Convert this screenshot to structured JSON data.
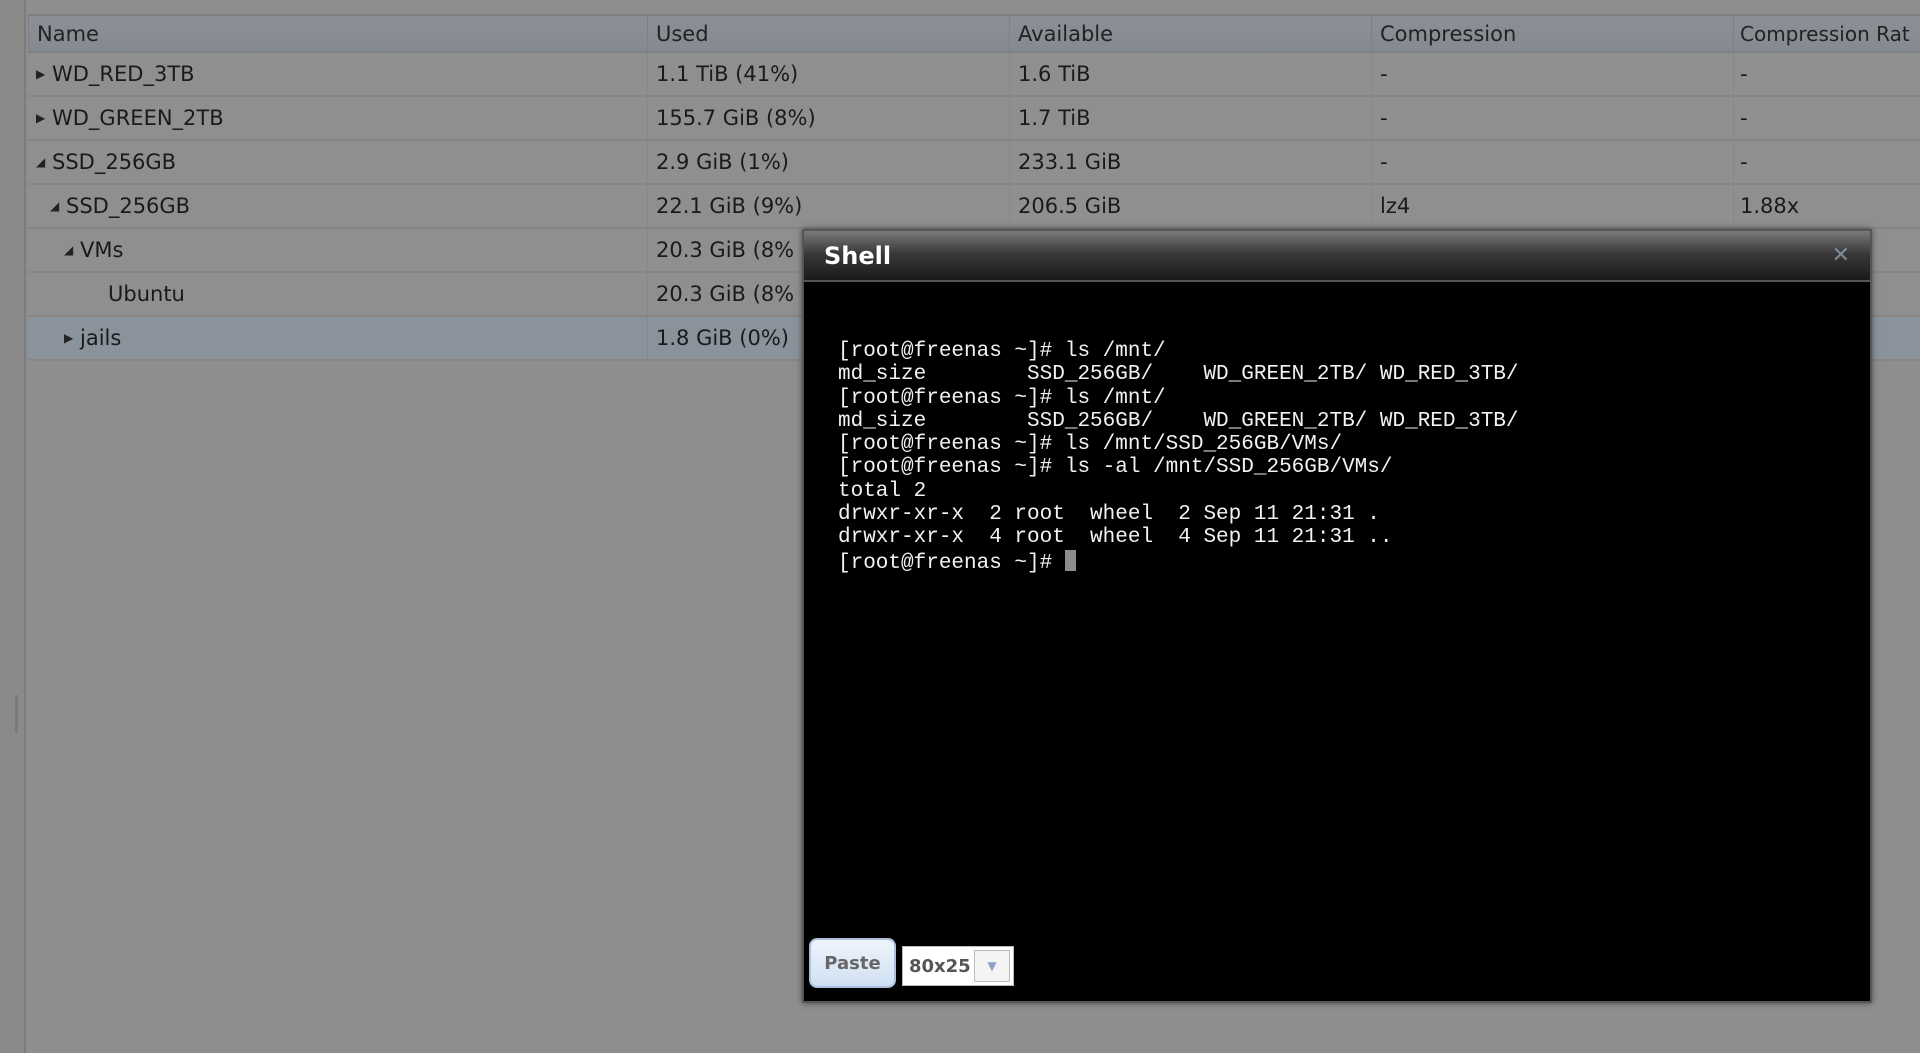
{
  "table": {
    "columns": [
      "Name",
      "Used",
      "Available",
      "Compression",
      "Compression Rat"
    ],
    "rows": [
      {
        "name": "WD_RED_3TB",
        "toggle": "collapsed",
        "level": 0,
        "used": "1.1 TiB (41%)",
        "available": "1.6 TiB",
        "compression": "-",
        "ratio": "-"
      },
      {
        "name": "WD_GREEN_2TB",
        "toggle": "collapsed",
        "level": 0,
        "used": "155.7 GiB (8%)",
        "available": "1.7 TiB",
        "compression": "-",
        "ratio": "-"
      },
      {
        "name": "SSD_256GB",
        "toggle": "expanded",
        "level": 0,
        "used": "2.9 GiB (1%)",
        "available": "233.1 GiB",
        "compression": "-",
        "ratio": "-"
      },
      {
        "name": "SSD_256GB",
        "toggle": "expanded",
        "level": 1,
        "used": "22.1 GiB (9%)",
        "available": "206.5 GiB",
        "compression": "lz4",
        "ratio": "1.88x"
      },
      {
        "name": "VMs",
        "toggle": "expanded",
        "level": 2,
        "used": "20.3 GiB (8%",
        "available": "",
        "compression": "",
        "ratio": ""
      },
      {
        "name": "Ubuntu",
        "toggle": "none",
        "level": 3,
        "used": "20.3 GiB (8%",
        "available": "",
        "compression": "",
        "ratio": ""
      },
      {
        "name": "jails",
        "toggle": "collapsed",
        "level": 2,
        "used": "1.8 GiB (0%)",
        "available": "",
        "compression": "",
        "ratio": "",
        "selected": true
      }
    ]
  },
  "shell": {
    "title": "Shell",
    "close_icon": "close-icon",
    "lines": [
      "[root@freenas ~]# ls /mnt/",
      "md_size        SSD_256GB/    WD_GREEN_2TB/ WD_RED_3TB/",
      "[root@freenas ~]# ls /mnt/",
      "md_size        SSD_256GB/    WD_GREEN_2TB/ WD_RED_3TB/",
      "[root@freenas ~]# ls /mnt/SSD_256GB/VMs/",
      "[root@freenas ~]# ls -al /mnt/SSD_256GB/VMs/",
      "total 2",
      "drwxr-xr-x  2 root  wheel  2 Sep 11 21:31 .",
      "drwxr-xr-x  4 root  wheel  4 Sep 11 21:31 ..",
      "[root@freenas ~]# "
    ],
    "paste_label": "Paste",
    "size_value": "80x25"
  }
}
